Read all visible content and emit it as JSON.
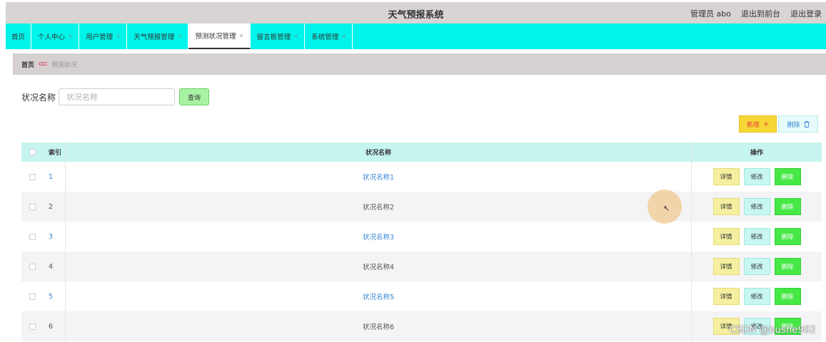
{
  "header": {
    "title": "天气预报系统",
    "user_label": "管理员 abo",
    "to_front": "退出到前台",
    "logout": "退出登录"
  },
  "nav": [
    {
      "label": "首页",
      "has_menu": false,
      "active": false
    },
    {
      "label": "个人中心",
      "has_menu": true,
      "active": false
    },
    {
      "label": "用户管理",
      "has_menu": true,
      "active": false
    },
    {
      "label": "天气预报管理",
      "has_menu": true,
      "active": false
    },
    {
      "label": "预测状况管理",
      "has_menu": true,
      "active": true
    },
    {
      "label": "留言板管理",
      "has_menu": true,
      "active": false
    },
    {
      "label": "系统管理",
      "has_menu": true,
      "active": false
    }
  ],
  "breadcrumb": {
    "home": "首页",
    "separator": "ccc",
    "current": "预测状况"
  },
  "search": {
    "label": "状况名称",
    "placeholder": "状况名称",
    "value": "",
    "button": "查询"
  },
  "actions": {
    "add": "新增",
    "add_icon": "plus-icon",
    "delete": "删除",
    "delete_icon": "trash-icon"
  },
  "table": {
    "headers": {
      "index": "索引",
      "name": "状况名称",
      "ops": "操作"
    },
    "rows": [
      {
        "index": "1",
        "name": "状况名称1"
      },
      {
        "index": "2",
        "name": "状况名称2"
      },
      {
        "index": "3",
        "name": "状况名称3"
      },
      {
        "index": "4",
        "name": "状况名称4"
      },
      {
        "index": "5",
        "name": "状况名称5"
      },
      {
        "index": "6",
        "name": "状况名称6"
      }
    ],
    "op_labels": {
      "detail": "详情",
      "edit": "修改",
      "remove": "删除"
    }
  },
  "watermark": "CSDN @bushe902",
  "colors": {
    "nav_bg": "#00f4ea",
    "header_bg": "#d9d4d4",
    "table_head_bg": "#c6f5ef",
    "add_bg": "#f6d735",
    "remove_bg": "#46e846"
  }
}
